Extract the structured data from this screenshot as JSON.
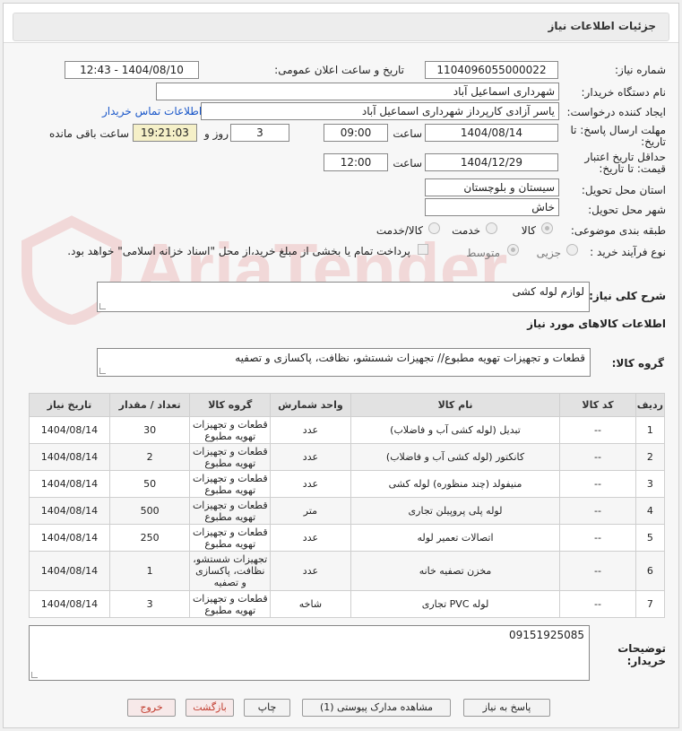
{
  "header": {
    "title": "جزئیات اطلاعات نیاز"
  },
  "form": {
    "need_number_label": "شماره نیاز:",
    "need_number": "1104096055000022",
    "announce_label": "تاریخ و ساعت اعلان عمومی:",
    "announce_value": "1404/08/10 - 12:43",
    "buyer_org_label": "نام دستگاه خریدار:",
    "buyer_org": "شهرداری اسماعیل آباد",
    "creator_label": "ایجاد کننده درخواست:",
    "creator": "یاسر آزادی کارپرداز شهرداری اسماعیل آباد",
    "contact_link": "اطلاعات تماس خریدار",
    "deadline_label": "مهلت ارسال پاسخ: تا تاریخ:",
    "deadline_date": "1404/08/14",
    "time_label": "ساعت",
    "deadline_time": "09:00",
    "days_value": "3",
    "days_label": "روز و",
    "remaining_time": "19:21:03",
    "remaining_label": "ساعت باقی مانده",
    "validity_label": "حداقل تاریخ اعتبار قیمت: تا تاریخ:",
    "validity_date": "1404/12/29",
    "validity_time": "12:00",
    "province_label": "استان محل تحویل:",
    "province": "سیستان و بلوچستان",
    "city_label": "شهر محل تحویل:",
    "city": "خاش",
    "category_label": "طبقه بندی موضوعی:",
    "category_options": [
      "کالا",
      "خدمت",
      "کالا/خدمت"
    ],
    "process_label": "نوع فرآیند خرید :",
    "process_options": [
      "جزیی",
      "متوسط"
    ],
    "payment_note": "پرداخت تمام یا بخشی از مبلغ خرید،از محل \"اسناد خزانه اسلامی\" خواهد بود."
  },
  "description": {
    "label": "شرح کلی نیاز:",
    "value": "لوازم لوله کشی"
  },
  "goods": {
    "section_title": "اطلاعات کالاهای مورد نیاز",
    "group_label": "گروه کالا:",
    "group_value": "قطعات و تجهیزات تهویه مطبوع// تجهیزات شستشو، نظافت، پاکسازی و تصفیه"
  },
  "table": {
    "headers": [
      "ردیف",
      "کد کالا",
      "نام کالا",
      "واحد شمارش",
      "گروه کالا",
      "تعداد / مقدار",
      "تاریخ نیاز"
    ],
    "rows": [
      [
        "1",
        "--",
        "تبدیل (لوله کشی آب و فاضلاب)",
        "عدد",
        "قطعات و تجهیزات تهویه مطبوع",
        "30",
        "1404/08/14"
      ],
      [
        "2",
        "--",
        "کانکتور (لوله کشی آب و فاضلاب)",
        "عدد",
        "قطعات و تجهیزات تهویه مطبوع",
        "2",
        "1404/08/14"
      ],
      [
        "3",
        "--",
        "منیفولد (چند منظوره) لوله کشی",
        "عدد",
        "قطعات و تجهیزات تهویه مطبوع",
        "50",
        "1404/08/14"
      ],
      [
        "4",
        "--",
        "لوله پلی پروپیلن تجاری",
        "متر",
        "قطعات و تجهیزات تهویه مطبوع",
        "500",
        "1404/08/14"
      ],
      [
        "5",
        "--",
        "اتصالات تعمیر لوله",
        "عدد",
        "قطعات و تجهیزات تهویه مطبوع",
        "250",
        "1404/08/14"
      ],
      [
        "6",
        "--",
        "مخزن تصفیه خانه",
        "عدد",
        "تجهیزات شستشو، نظافت، پاکسازی و تصفیه",
        "1",
        "1404/08/14"
      ],
      [
        "7",
        "--",
        "لوله PVC تجاری",
        "شاخه",
        "قطعات و تجهیزات تهویه مطبوع",
        "3",
        "1404/08/14"
      ]
    ]
  },
  "buyer_notes": {
    "label": "توضیحات خریدار:",
    "value": "09151925085"
  },
  "buttons": {
    "reply": "پاسخ به نیاز",
    "attachments": "مشاهده مدارک پیوستی (1)",
    "print": "چاپ",
    "back": "بازگشت",
    "exit": "خروج"
  },
  "watermark": {
    "text": "AriaTender.neT"
  }
}
